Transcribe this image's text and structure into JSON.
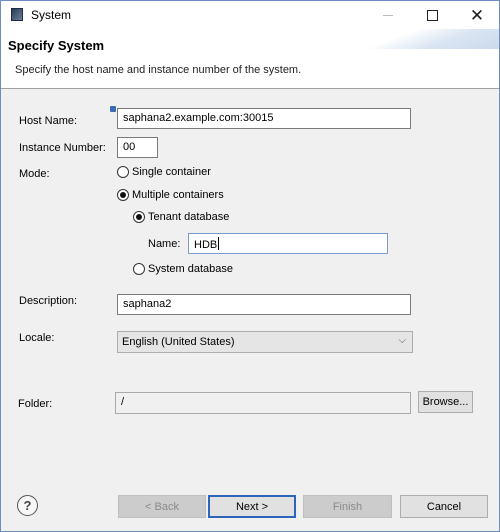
{
  "window": {
    "title": "System",
    "icon": "app-icon",
    "controls": [
      "minimize-icon",
      "maximize-icon",
      "close-icon"
    ],
    "close_glyph": "✕"
  },
  "banner": {
    "title": "Specify System",
    "description": "Specify the host name and instance number of the system."
  },
  "form": {
    "host_name": {
      "label": "Host Name:",
      "value": "saphana2.example.com:30015"
    },
    "instance_number": {
      "label": "Instance Number:",
      "value": "00"
    },
    "mode": {
      "label": "Mode:",
      "options": [
        {
          "label": "Single container",
          "selected": false
        },
        {
          "label": "Multiple containers",
          "selected": true
        }
      ],
      "sub_options": [
        {
          "label": "Tenant database",
          "selected": true
        },
        {
          "label": "System database",
          "selected": false
        }
      ],
      "tenant_name": {
        "label": "Name:",
        "value": "HDB"
      }
    },
    "description": {
      "label": "Description:",
      "value": "saphana2"
    },
    "locale": {
      "label": "Locale:",
      "value": "English (United States)",
      "chevron": "⌵"
    },
    "folder": {
      "label": "Folder:",
      "value": "/",
      "browse_label": "Browse..."
    }
  },
  "footer": {
    "help_glyph": "?",
    "back_label": "< Back",
    "next_label": "Next >",
    "finish_label": "Finish",
    "cancel_label": "Cancel"
  }
}
